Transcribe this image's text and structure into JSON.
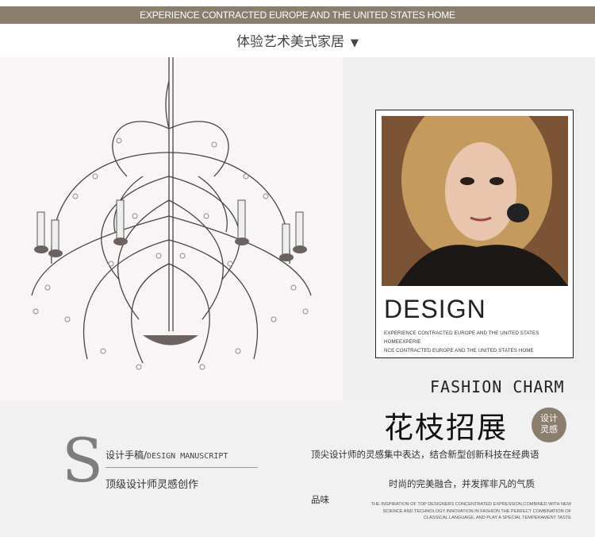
{
  "header": {
    "banner_text": "EXPERIENCE CONTRACTED EUROPE AND THE UNITED STATES HOME",
    "subtitle": "体验艺术美式家居",
    "arrow": "▼"
  },
  "card": {
    "title": "DESIGN",
    "desc_line1": "EXPERIENCE CONTRACTED EUROPE AND THE UNITED STATES HOMEEXPERIE",
    "desc_line2": "NCE CONTRACTED EUROPE AND THE UNITED STATES HOME"
  },
  "feature": {
    "fashion": "FASHION CHARM",
    "cn_title": "花枝招展",
    "badge_line1": "设计",
    "badge_line2": "灵感"
  },
  "manuscript": {
    "letter": "S",
    "line1_cn": "设计手稿/",
    "line1_en": "DESIGN MANUSCRIPT",
    "line2": "顶级设计师灵感创作"
  },
  "description": {
    "para1": "顶尖设计师的灵感集中表达，结合新型创新科技在经典语",
    "para2": "时尚的完美融合，并发挥非凡的气质",
    "para3": "品味",
    "small_line1": "THE INSPIRATION OF TOP DESIGNERS CONCENTRATED EXPRESSION,COMBINED WITH NEW",
    "small_line2": "SCIENCE AND TECHNOLOGY INNOVATION IN FASHION THE PERFECT COMBINATION OF",
    "small_line3": "CLASSICAL LANGUAGE, AND PLAY A SPECIAL TEMPERAMENT TASTE"
  },
  "colors": {
    "accent": "#8a7e6e",
    "text_dark": "#222222"
  }
}
